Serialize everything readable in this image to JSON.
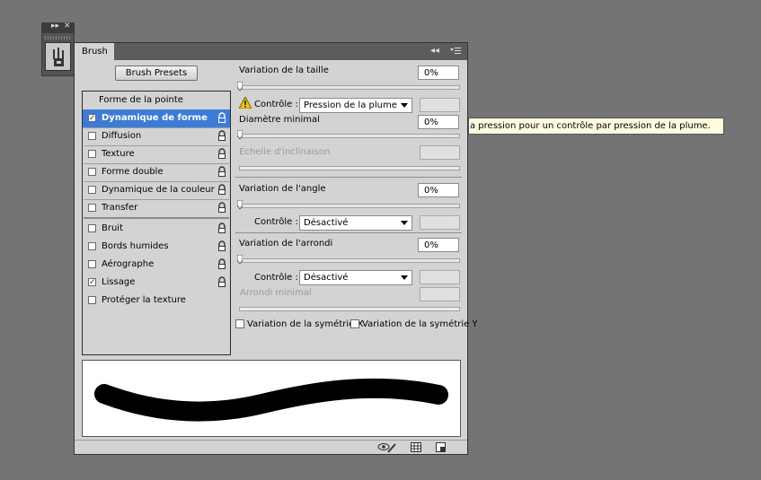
{
  "panel": {
    "tab_label": "Brush",
    "collapse_icon": "double-chevron-left-icon",
    "menu_icon": "panel-menu-icon"
  },
  "mini_panel": {
    "expand_icon": "double-chevron-right-icon",
    "close_icon": "close-icon",
    "brush_tool_icon": "brush-presets-icon"
  },
  "presets_button": "Brush Presets",
  "list": {
    "header": "Forme de la pointe",
    "items": [
      {
        "label": "Dynamique de forme",
        "checked": true,
        "selected": true,
        "locked": true
      },
      {
        "label": "Diffusion",
        "checked": false,
        "locked": true
      },
      {
        "label": "Texture",
        "checked": false,
        "locked": true
      },
      {
        "label": "Forme double",
        "checked": false,
        "locked": true
      },
      {
        "label": "Dynamique de la couleur",
        "checked": false,
        "locked": true
      },
      {
        "label": "Transfer",
        "checked": false,
        "locked": true
      },
      {
        "label": "Bruit",
        "checked": false,
        "locked": true
      },
      {
        "label": "Bords humides",
        "checked": false,
        "locked": true
      },
      {
        "label": "Aérographe",
        "checked": false,
        "locked": true
      },
      {
        "label": "Lissage",
        "checked": true,
        "locked": true
      },
      {
        "label": "Protéger la texture",
        "checked": false,
        "locked": true
      }
    ]
  },
  "controls": {
    "size_jitter": {
      "label": "Variation de la taille",
      "value": "0%"
    },
    "size_control": {
      "label": "Contrôle :",
      "value": "Pression de la plume",
      "warning_icon": "warning-icon"
    },
    "min_diameter": {
      "label": "Diamètre minimal",
      "value": "0%"
    },
    "tilt_scale": {
      "label": "Echelle d'inclinaison",
      "value": ""
    },
    "angle_jitter": {
      "label": "Variation de l'angle",
      "value": "0%"
    },
    "angle_control": {
      "label": "Contrôle :",
      "value": "Désactivé"
    },
    "roundness_jitter": {
      "label": "Variation de l'arrondi",
      "value": "0%"
    },
    "roundness_control": {
      "label": "Contrôle :",
      "value": "Désactivé"
    },
    "min_roundness": {
      "label": "Arrondi minimal",
      "value": ""
    },
    "flip_x": {
      "label": "Variation de la symétrie X",
      "checked": false
    },
    "flip_y": {
      "label": "Variation de la symétrie Y",
      "checked": false
    }
  },
  "bottom_icons": [
    "eye-brush-icon",
    "grid-icon",
    "new-preset-icon"
  ],
  "tooltip": "a pression pour un contrôle par pression de la plume."
}
